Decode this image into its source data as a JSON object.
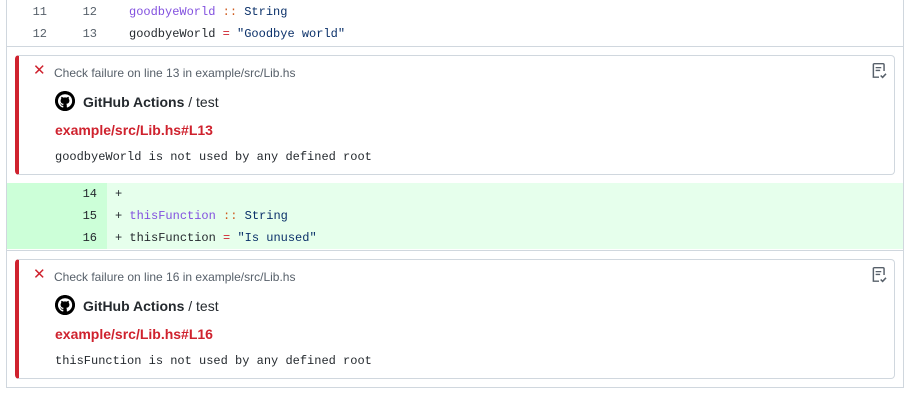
{
  "diff": {
    "context_rows": [
      {
        "old": "11",
        "new": "12",
        "tokens": [
          {
            "t": "goodbyeWorld",
            "c": "purple"
          },
          {
            "t": " ",
            "c": ""
          },
          {
            "t": "::",
            "c": "orange"
          },
          {
            "t": " ",
            "c": ""
          },
          {
            "t": "String",
            "c": "blue"
          }
        ]
      },
      {
        "old": "12",
        "new": "13",
        "tokens": [
          {
            "t": "goodbyeWorld ",
            "c": ""
          },
          {
            "t": "=",
            "c": "red"
          },
          {
            "t": " ",
            "c": ""
          },
          {
            "t": "\"Goodbye world\"",
            "c": "blue"
          }
        ]
      }
    ],
    "added_rows": [
      {
        "new": "14",
        "tokens": [
          {
            "t": "+ ",
            "c": ""
          }
        ]
      },
      {
        "new": "15",
        "tokens": [
          {
            "t": "+ ",
            "c": ""
          },
          {
            "t": "thisFunction",
            "c": "purple"
          },
          {
            "t": " ",
            "c": ""
          },
          {
            "t": "::",
            "c": "orange"
          },
          {
            "t": " ",
            "c": ""
          },
          {
            "t": "String",
            "c": "blue"
          }
        ]
      },
      {
        "new": "16",
        "tokens": [
          {
            "t": "+ ",
            "c": ""
          },
          {
            "t": "thisFunction ",
            "c": ""
          },
          {
            "t": "=",
            "c": "red"
          },
          {
            "t": " ",
            "c": ""
          },
          {
            "t": "\"Is unused\"",
            "c": "blue"
          }
        ]
      }
    ]
  },
  "annotations": [
    {
      "header": "Check failure on line 13 in example/src/Lib.hs",
      "app": "GitHub Actions",
      "separator": " / ",
      "job": "test",
      "file_link": "example/src/Lib.hs#L13",
      "message": "goodbyeWorld is not used by any defined root"
    },
    {
      "header": "Check failure on line 16 in example/src/Lib.hs",
      "app": "GitHub Actions",
      "separator": " / ",
      "job": "test",
      "file_link": "example/src/Lib.hs#L16",
      "message": "thisFunction is not used by any defined root"
    }
  ],
  "icons": {
    "failure": "x-icon",
    "annotation_action": "checklist-icon",
    "app_logo": "github-logo-icon"
  },
  "colors": {
    "failure_red": "#cf222e",
    "added_bg": "#e6ffec",
    "added_gutter": "#ccffd8"
  }
}
